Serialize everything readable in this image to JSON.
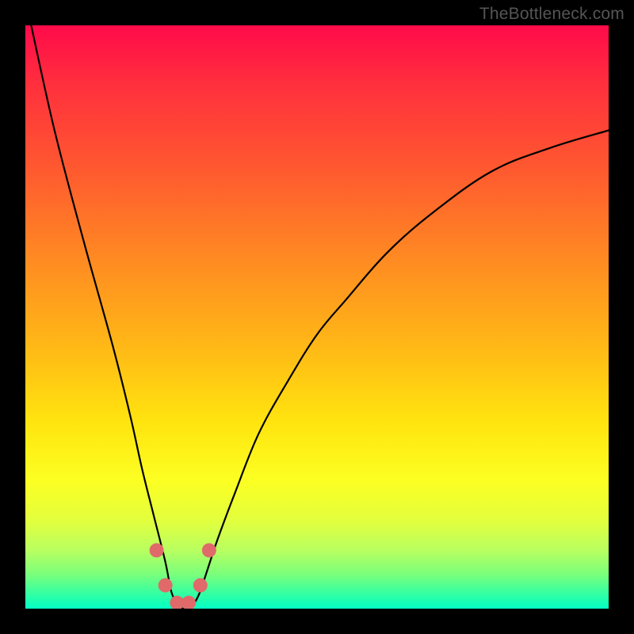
{
  "watermark": "TheBottleneck.com",
  "chart_data": {
    "type": "line",
    "title": "",
    "xlabel": "",
    "ylabel": "",
    "xlim": [
      0,
      100
    ],
    "ylim": [
      0,
      100
    ],
    "grid": false,
    "legend": false,
    "background": {
      "gradient": "vertical",
      "stops": [
        {
          "pos": 0,
          "color": "#ff0a4a"
        },
        {
          "pos": 50,
          "color": "#ffb816"
        },
        {
          "pos": 80,
          "color": "#fcff22"
        },
        {
          "pos": 100,
          "color": "#07ffc7"
        }
      ]
    },
    "series": [
      {
        "name": "bottleneck-curve",
        "color": "#000000",
        "x": [
          1,
          5,
          10,
          15,
          18,
          20,
          22,
          24,
          25,
          26,
          27,
          28,
          29,
          30,
          31,
          33,
          36,
          40,
          45,
          50,
          55,
          62,
          70,
          80,
          90,
          100
        ],
        "values": [
          100,
          82,
          63,
          45,
          33,
          24,
          16,
          8,
          3,
          1,
          0,
          0,
          1,
          3,
          6,
          12,
          20,
          30,
          39,
          47,
          53,
          61,
          68,
          75,
          79,
          82
        ]
      }
    ],
    "markers": [
      {
        "x": 22.5,
        "y": 10,
        "color": "#e06a6a"
      },
      {
        "x": 24,
        "y": 4,
        "color": "#e06a6a"
      },
      {
        "x": 26,
        "y": 1,
        "color": "#e06a6a"
      },
      {
        "x": 28,
        "y": 1,
        "color": "#e06a6a"
      },
      {
        "x": 30,
        "y": 4,
        "color": "#e06a6a"
      },
      {
        "x": 31.5,
        "y": 10,
        "color": "#e06a6a"
      }
    ]
  }
}
